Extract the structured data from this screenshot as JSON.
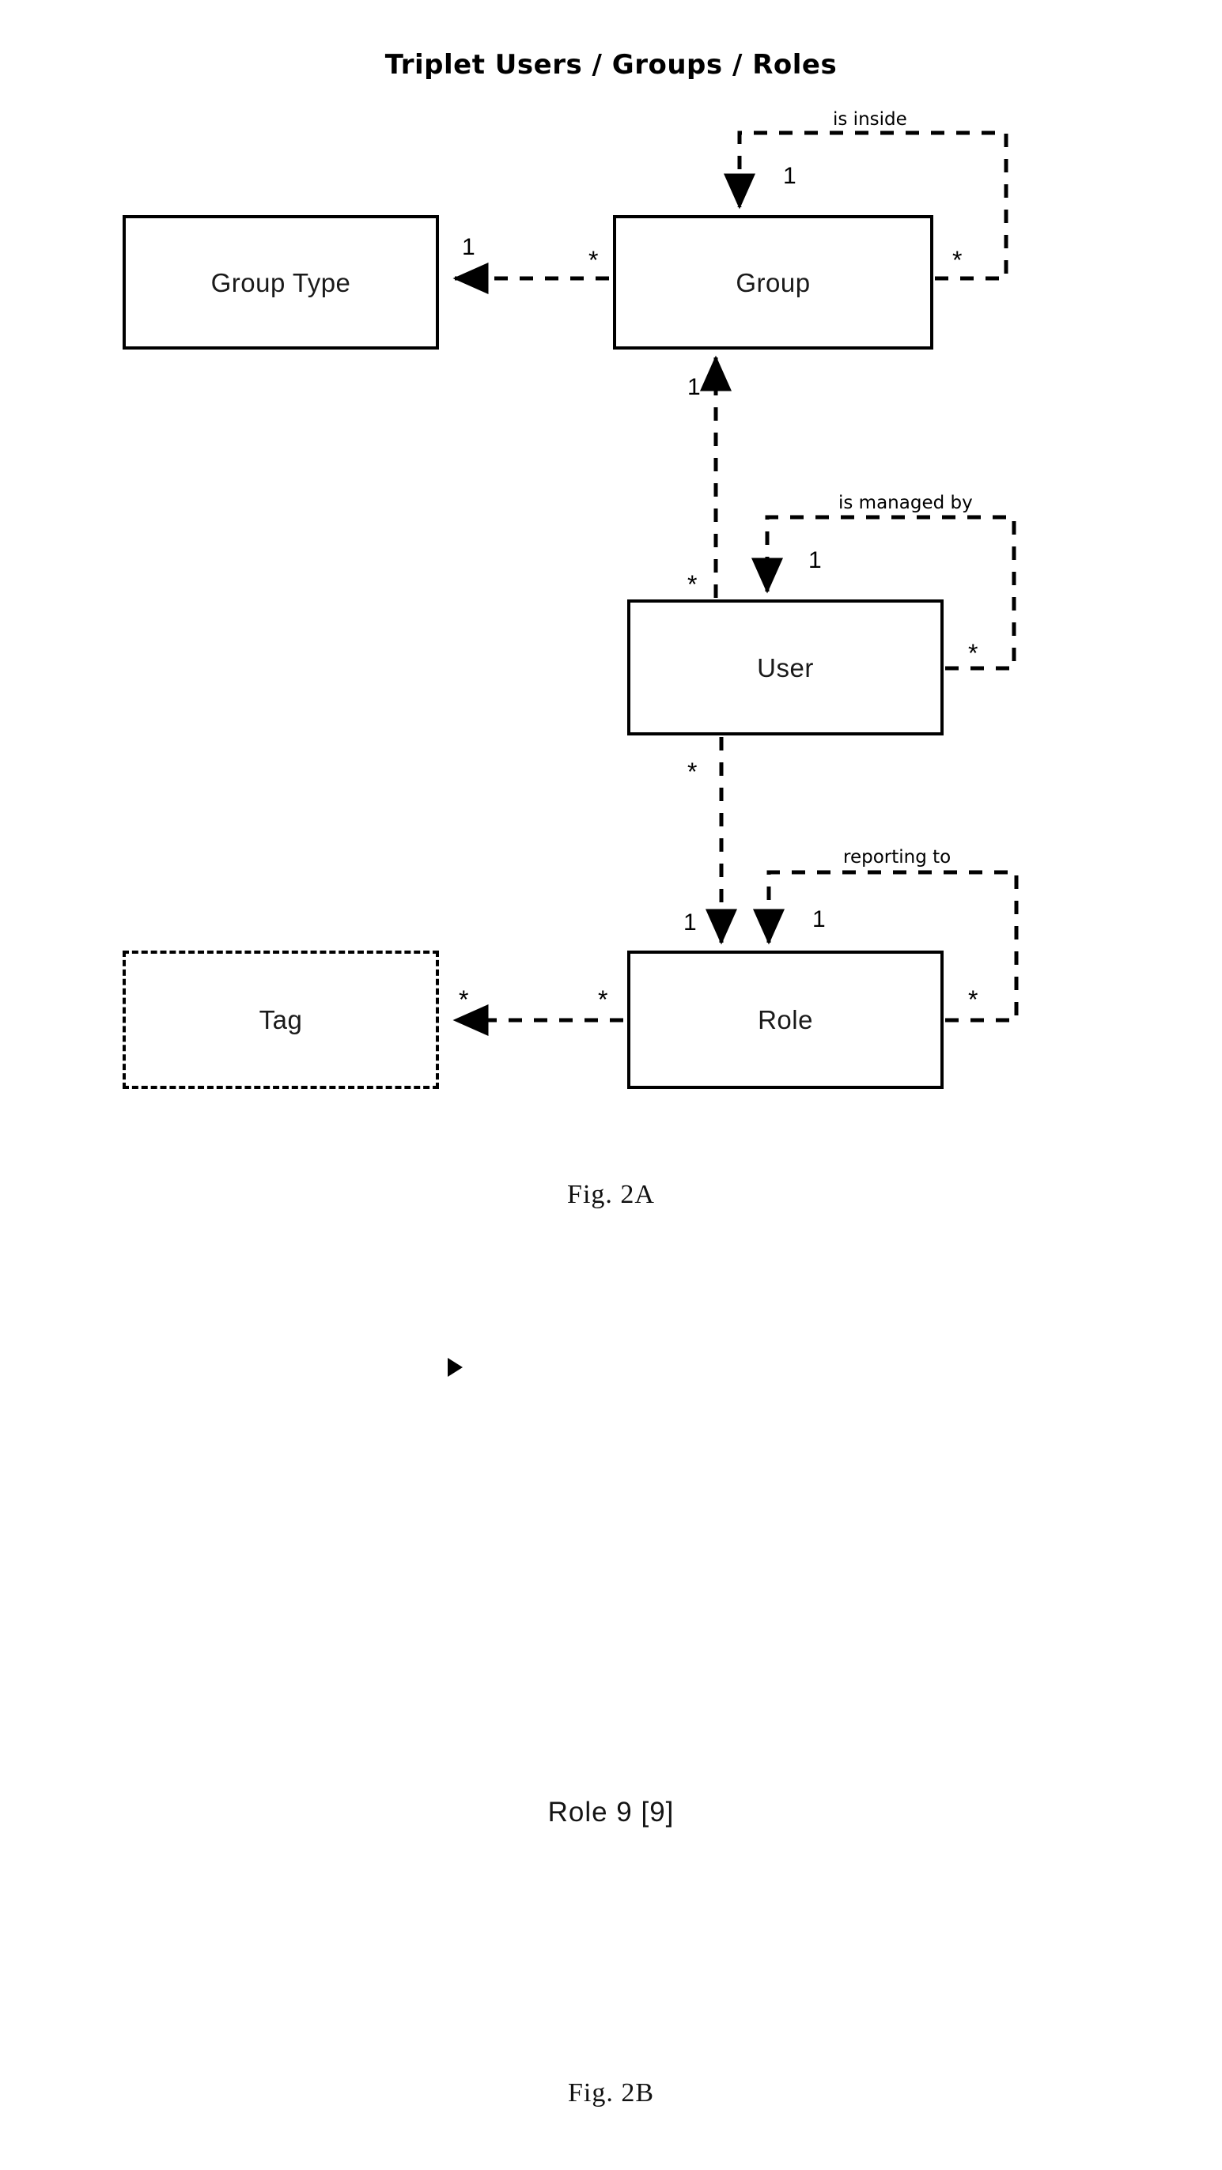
{
  "figure": {
    "title": "Triplet Users / Groups / Roles",
    "captions": {
      "fig_2a": "Fig. 2A",
      "fig_2b": "Fig. 2B"
    }
  },
  "entities": [
    {
      "id": "group-type",
      "label": "Group Type",
      "border": "solid"
    },
    {
      "id": "group",
      "label": "Group",
      "border": "solid"
    },
    {
      "id": "user",
      "label": "User",
      "border": "solid"
    },
    {
      "id": "role",
      "label": "Role",
      "border": "solid"
    },
    {
      "id": "tag",
      "label": "Tag",
      "border": "dashed"
    }
  ],
  "relationship_labels": {
    "is_inside": "is inside",
    "is_managed_by": "is managed by",
    "reporting_to": "reporting to"
  },
  "multiplicities": {
    "inside_one": "1",
    "group_right_star": "*",
    "group_left_star": "*",
    "group_type_one": "1",
    "group_up_one": "1",
    "user_up_star": "*",
    "managed_one": "1",
    "user_right_star": "*",
    "user_down_star": "*",
    "role_down_one": "1",
    "reporting_one": "1",
    "role_right_star": "*",
    "role_left_star": "*",
    "tag_right_star": "*"
  },
  "fig2b": {
    "marker": "play-triangle",
    "text": "Role 9 [9]"
  },
  "colors": {
    "stroke": "#000000",
    "background": "#ffffff",
    "text": "#111111"
  }
}
